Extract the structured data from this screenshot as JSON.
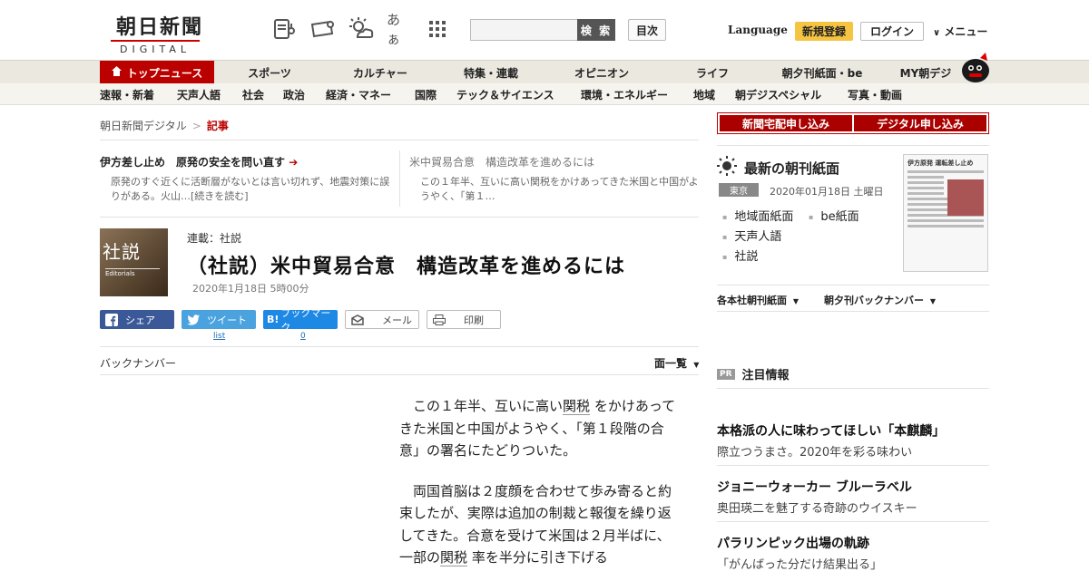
{
  "header": {
    "logo_jp": "朝日新聞",
    "logo_en": "DIGITAL",
    "icons": [
      "news-reader-icon",
      "ticket-icon",
      "weather-icon",
      "font-size-icon",
      "grid-menu-icon"
    ],
    "font_glyph": "あぁ",
    "search_placeholder": "",
    "search_button": "検 索",
    "mokuji": "目次",
    "language": "Language",
    "register": "新規登録",
    "login": "ログイン",
    "menu": "メニュー"
  },
  "nav1": {
    "items": [
      "トップニュース",
      "スポーツ",
      "カルチャー",
      "特集・連載",
      "オピニオン",
      "ライフ",
      "朝夕刊紙面・be",
      "MY朝デジ"
    ]
  },
  "nav2": {
    "items": [
      "速報・新着",
      "天声人語",
      "社会",
      "政治",
      "経済・マネー",
      "国際",
      "テック＆サイエンス",
      "環境・エネルギー",
      "地域",
      "朝デジスペシャル",
      "写真・動画"
    ]
  },
  "breadcrumb": {
    "home": "朝日新聞デジタル",
    "current": "記事"
  },
  "related": [
    {
      "title": "伊方差し止め　原発の安全を問い直す",
      "desc": "原発のすぐ近くに活断層がないとは言い切れず、地震対策に誤りがある。火山…[続きを読む]"
    },
    {
      "title": "米中貿易合意　構造改革を進めるには",
      "desc": "この１年半、互いに高い関税をかけあってきた米国と中国がようやく、「第１…"
    }
  ],
  "article": {
    "thumb_kanji": "社説",
    "thumb_en": "Editorials",
    "series": "連載：社説",
    "title": "（社説）米中貿易合意　構造改革を進めるには",
    "date": "2020年1月18日 5時00分",
    "share": {
      "facebook": "シェア",
      "twitter": "ツイート",
      "hatena": "ブックマーク",
      "mail": "メール",
      "print": "印刷",
      "twitter_count": "list",
      "hatena_count": "0"
    },
    "backnumber": "バックナンバー",
    "page_list": "面一覧",
    "p1_a": "この１年半、互いに高い",
    "p1_kw": "関税",
    "p1_b": "をかけあってきた米国と中国がようやく、「第１段階の合意」の署名にたどりついた。",
    "p2_a": "両国首脳は２度顔を合わせて歩み寄ると約束したが、実際は追加の制裁と報復を繰り返してきた。合意を受けて米国は２月半ばに、一部の",
    "p2_kw": "関税",
    "p2_b": "率を半分に引き下げる"
  },
  "sidebar": {
    "cta_home": "新聞宅配申し込み",
    "cta_digital": "デジタル申し込み",
    "paper_title": "最新の朝刊紙面",
    "region": "東京",
    "paper_date": "2020年01月18日 土曜日",
    "paper_links": [
      "地域面紙面",
      "be紙面",
      "天声人語",
      "社説"
    ],
    "paper_thumb_head": "伊方原発 運転差し止め",
    "dd1": "各本社朝刊紙面",
    "dd2": "朝夕刊バックナンバー",
    "pr_tag": "PR",
    "pr_title": "注目情報",
    "ads": [
      {
        "title": "本格派の人に味わってほしい「本麒麟」",
        "desc": "際立つうまさ。2020年を彩る味わい"
      },
      {
        "title": "ジョニーウォーカー ブルーラベル",
        "desc": "奥田瑛二を魅了する奇跡のウイスキー"
      },
      {
        "title": "パラリンピック出場の軌跡",
        "desc": "「がんばった分だけ結果出る」"
      }
    ]
  },
  "colors": {
    "accent": "#bb0000",
    "nav_bg": "#ebe8e0",
    "register": "#f5c542"
  }
}
